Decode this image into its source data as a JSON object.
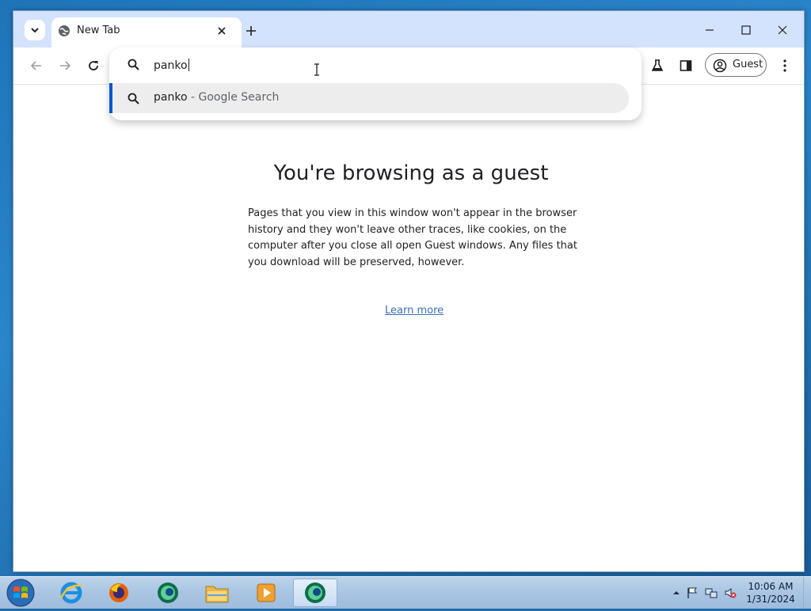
{
  "browser": {
    "tab": {
      "title": "New Tab"
    },
    "toolbar": {
      "profile_label": "Guest"
    },
    "omnibox": {
      "input_value": "panko",
      "suggestion": {
        "query": "panko",
        "separator": " - ",
        "provider": "Google Search"
      }
    },
    "page": {
      "heading": "You're browsing as a guest",
      "body": "Pages that you view in this window won't appear in the browser history and they won't leave other traces, like cookies, on the computer after you close all open Guest windows. Any files that you download will be preserved, however.",
      "link": "Learn more"
    }
  },
  "taskbar": {
    "items": [
      "internet-explorer-icon",
      "firefox-icon",
      "chrome-icon",
      "file-explorer-icon",
      "media-player-icon",
      "chrome-icon"
    ],
    "clock": {
      "time": "10:06 AM",
      "date": "1/31/2024"
    }
  },
  "colors": {
    "titlebar": "#d3e3fd",
    "accent": "#0b57d0",
    "link": "#3b6fb6",
    "suggestion_bg": "#ededed"
  }
}
